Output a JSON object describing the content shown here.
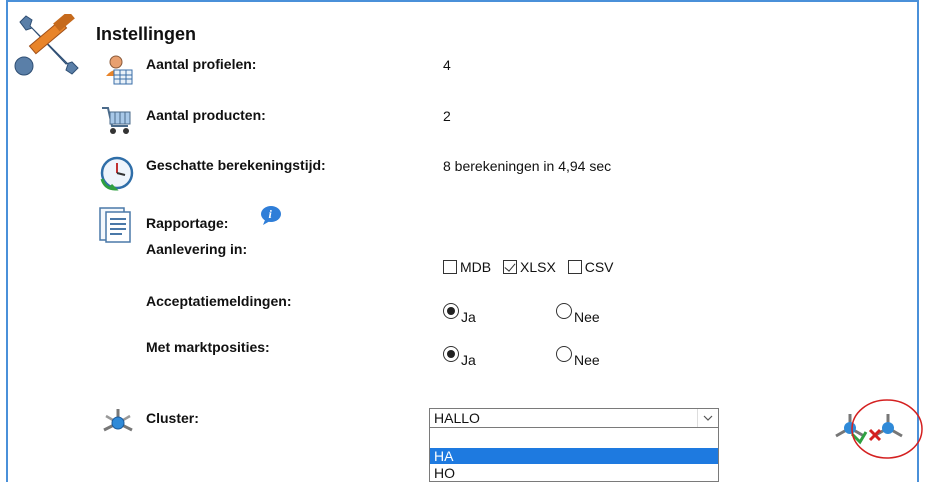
{
  "header": {
    "title": "Instellingen"
  },
  "rows": {
    "profielen": {
      "label": "Aantal profielen:",
      "value": "4"
    },
    "producten": {
      "label": "Aantal producten:",
      "value": "2"
    },
    "tijd": {
      "label": "Geschatte berekeningstijd:",
      "value": "8 berekeningen in 4,94 sec"
    }
  },
  "rapportage": {
    "label": "Rapportage:"
  },
  "aanlevering": {
    "label": "Aanlevering in:",
    "options": [
      {
        "label": "MDB",
        "checked": false
      },
      {
        "label": "XLSX",
        "checked": true
      },
      {
        "label": "CSV",
        "checked": false
      }
    ]
  },
  "acceptatie": {
    "label": "Acceptatiemeldingen:",
    "yes": "Ja",
    "no": "Nee",
    "selected": "Ja"
  },
  "markt": {
    "label": "Met marktposities:",
    "yes": "Ja",
    "no": "Nee",
    "selected": "Ja"
  },
  "cluster": {
    "label": "Cluster:",
    "selected": "HALLO",
    "options": [
      "",
      "HA",
      "HO"
    ],
    "highlighted": "HA"
  },
  "colors": {
    "frame": "#4a90d9",
    "highlight": "#1e7ae0",
    "circle": "#d42020"
  }
}
